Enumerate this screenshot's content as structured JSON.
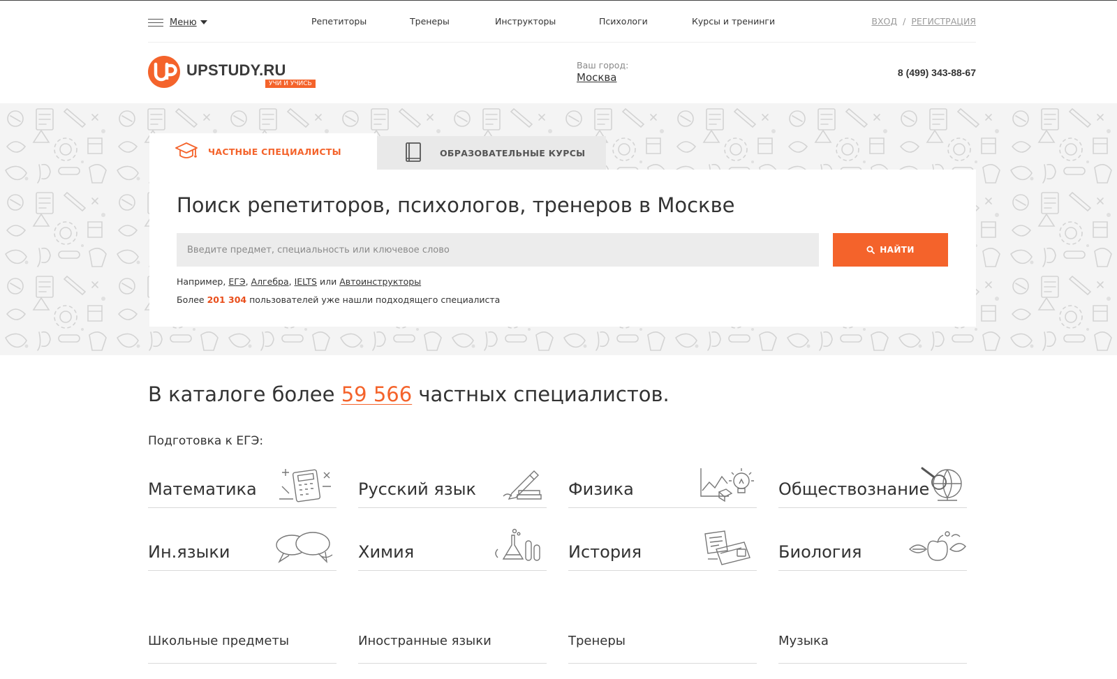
{
  "nav": {
    "menu_label": "Меню",
    "links": [
      "Репетиторы",
      "Тренеры",
      "Инструкторы",
      "Психологи",
      "Курсы и тренинги"
    ],
    "login": "ВХОД",
    "separator": "/",
    "register": "РЕГИСТРАЦИЯ"
  },
  "header": {
    "logo_name": "UPSTUDY.RU",
    "logo_tagline": "УЧИ И УЧИСЬ",
    "city_label": "Ваш город:",
    "city": "Москва",
    "phone": "8 (499) 343-88-67"
  },
  "search": {
    "tabs": [
      {
        "label": "ЧАСТНЫЕ СПЕЦИАЛИСТЫ",
        "icon": "graduation-cap-icon",
        "active": true
      },
      {
        "label": "ОБРАЗОВАТЕЛЬНЫЕ КУРСЫ",
        "icon": "book-icon",
        "active": false
      }
    ],
    "title": "Поиск репетиторов, психологов, тренеров в Москве",
    "placeholder": "Введите предмет, специальность или ключевое слово",
    "button_label": "НАЙТИ",
    "examples_prefix": "Например,",
    "examples": [
      "ЕГЭ",
      "Алгебра",
      "IELTS",
      "Автоинструкторы"
    ],
    "examples_or": "или",
    "users_prefix": "Более",
    "users_count": "201 304",
    "users_suffix": "пользователей уже нашли подходящего специалиста"
  },
  "catalog": {
    "heading_prefix": "В каталоге более",
    "heading_count": "59 566",
    "heading_suffix": "частных специалистов.",
    "ege_label": "Подготовка к ЕГЭ:",
    "subjects": [
      {
        "label": "Математика",
        "icon": "calculator-icon"
      },
      {
        "label": "Русский язык",
        "icon": "pen-books-icon"
      },
      {
        "label": "Физика",
        "icon": "lightbulb-graph-icon"
      },
      {
        "label": "Обществознание",
        "icon": "globe-magnifier-icon"
      },
      {
        "label": "Ин.языки",
        "icon": "speech-bubbles-icon"
      },
      {
        "label": "Химия",
        "icon": "flasks-icon"
      },
      {
        "label": "История",
        "icon": "books-notes-icon"
      },
      {
        "label": "Биология",
        "icon": "apple-leaves-icon"
      }
    ],
    "categories": [
      "Школьные предметы",
      "Иностранные языки",
      "Тренеры",
      "Музыка"
    ]
  },
  "colors": {
    "accent": "#f4632b",
    "text": "#333333",
    "muted": "#888888",
    "input_bg": "#ececec",
    "hero_bg": "#f4f4f4"
  }
}
